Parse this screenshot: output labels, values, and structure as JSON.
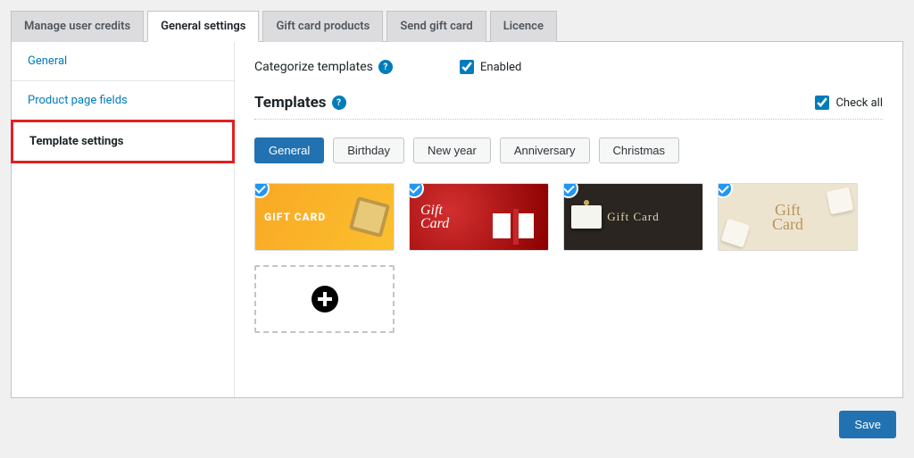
{
  "tabs": {
    "manage": "Manage user credits",
    "general": "General settings",
    "giftcard": "Gift card products",
    "sendgift": "Send gift card",
    "licence": "Licence"
  },
  "sidebar": {
    "general": "General",
    "product_page": "Product page fields",
    "template_settings": "Template settings"
  },
  "categorize": {
    "label": "Categorize templates",
    "checkbox_label": "Enabled",
    "checked": true
  },
  "templates_section": {
    "title": "Templates",
    "check_all_label": "Check all",
    "check_all_checked": true
  },
  "categories": [
    {
      "label": "General",
      "active": true
    },
    {
      "label": "Birthday",
      "active": false
    },
    {
      "label": "New year",
      "active": false
    },
    {
      "label": "Anniversary",
      "active": false
    },
    {
      "label": "Christmas",
      "active": false
    }
  ],
  "templates": [
    {
      "name": "yellow-gift-card",
      "text": "GIFT CARD",
      "selected": true
    },
    {
      "name": "red-gift-card",
      "text": "Gift\nCard",
      "selected": true
    },
    {
      "name": "black-gift-card",
      "text": "Gift Card",
      "selected": true
    },
    {
      "name": "beige-gift-card",
      "text": "Gift\nCard",
      "selected": true
    }
  ],
  "footer": {
    "save": "Save"
  }
}
